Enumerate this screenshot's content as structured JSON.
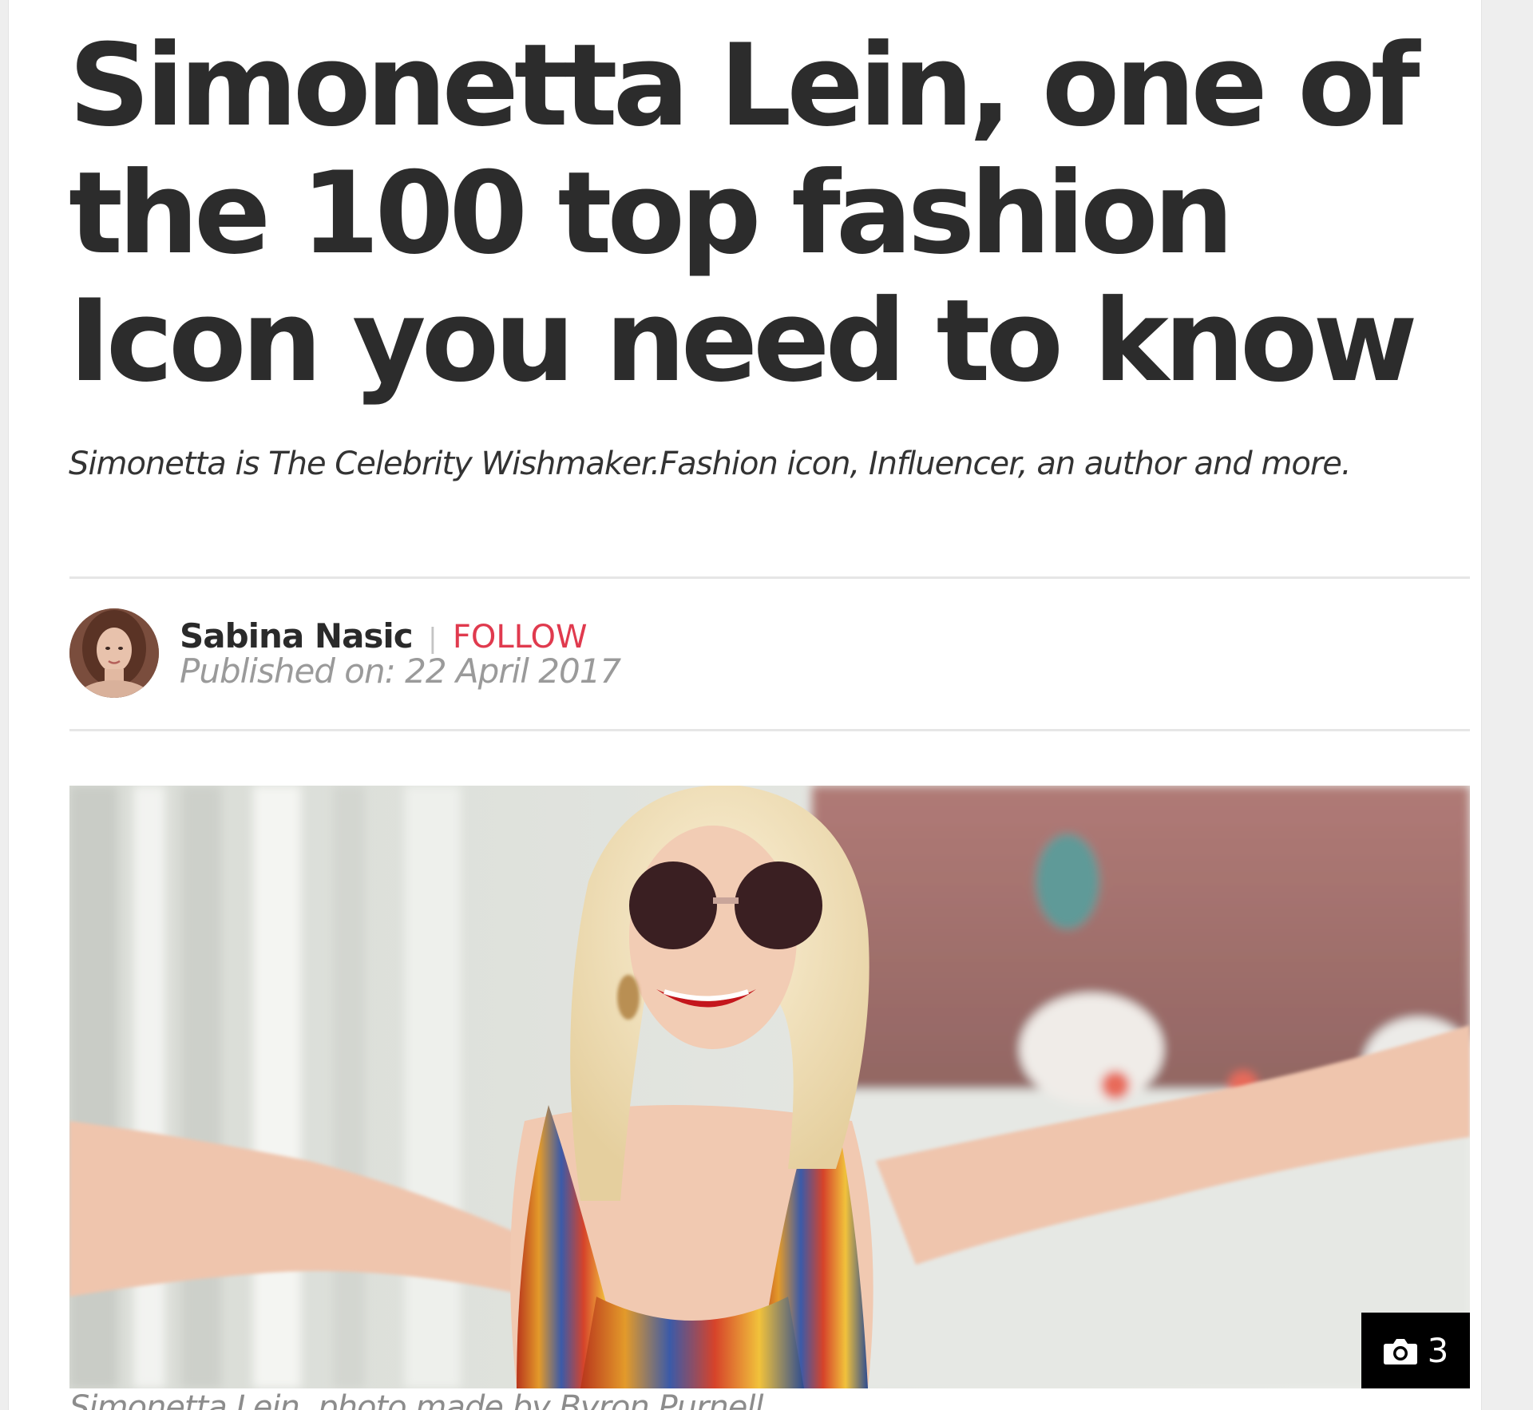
{
  "article": {
    "title": "Simonetta Lein, one of the 100 top fashion Icon you need to know",
    "subtitle": "Simonetta is The Celebrity Wishmaker.Fashion icon, Influencer, an author and more."
  },
  "byline": {
    "author_name": "Sabina Nasic",
    "separator": "|",
    "follow_label": "FOLLOW",
    "published": "Published on: 22 April 2017"
  },
  "photo": {
    "gallery_count": "3",
    "caption": "Simonetta Lein, photo made by Byron Purnell"
  },
  "icons": {
    "gallery": "camera-icon",
    "avatar": "author-avatar"
  },
  "colors": {
    "follow": "#e03a4e",
    "title": "#2c2c2c",
    "badge_bg": "#000000"
  }
}
